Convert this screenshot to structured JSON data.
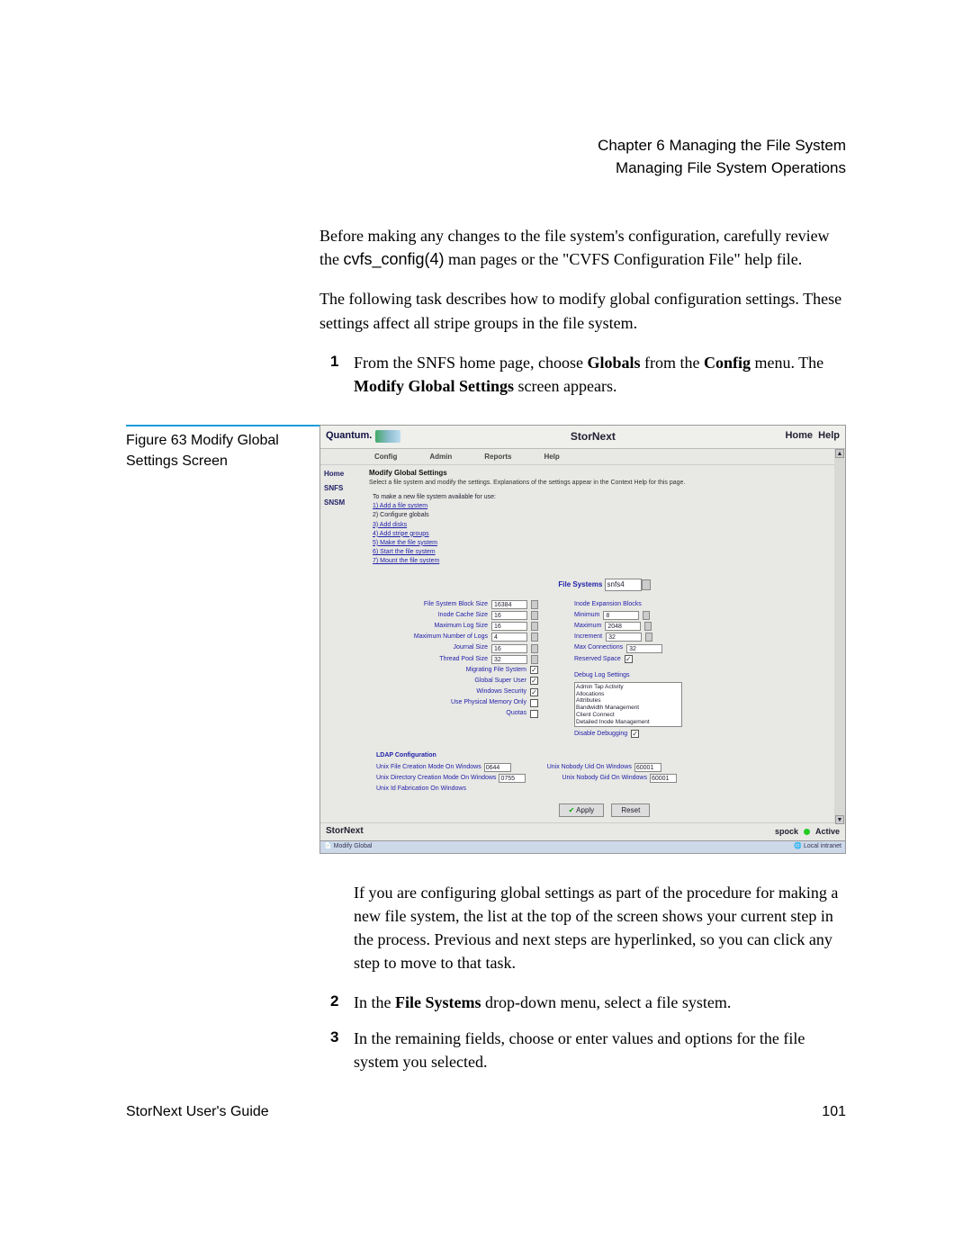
{
  "header": {
    "chapter": "Chapter 6  Managing the File System",
    "section": "Managing File System Operations"
  },
  "intro1": "Before making any changes to the file system's configuration, carefully review the ",
  "intro1_code": "cvfs_config(4)",
  "intro1_rest": " man pages or the \"CVFS Configuration File\" help file.",
  "intro2": "The following task describes how to modify global configuration settings. These settings affect all stripe groups in the file system.",
  "step1_a": "From the SNFS home page, choose ",
  "step1_b": "Globals",
  "step1_c": " from the ",
  "step1_d": "Config",
  "step1_e": " menu. The ",
  "step1_f": "Modify Global Settings",
  "step1_g": " screen appears.",
  "figure": {
    "label": "Figure 63  Modify Global Settings Screen"
  },
  "after1": "If you are configuring global settings as part of the procedure for making a new file system, the list at the top of the screen shows your current step in the process. Previous and next steps are hyperlinked, so you can click any step to move to that task.",
  "step2_a": "In the ",
  "step2_b": "File Systems",
  "step2_c": " drop-down menu, select a file system.",
  "step3": "In the remaining fields, choose or enter values and options for the file system you selected.",
  "footer": {
    "left": "StorNext User's Guide",
    "right": "101"
  },
  "ss": {
    "brand": "Quantum.",
    "title": "StorNext",
    "home": "Home",
    "help": "Help",
    "menu": {
      "m1": "Config",
      "m2": "Admin",
      "m3": "Reports",
      "m4": "Help"
    },
    "side": {
      "s1": "Home",
      "s2": "SNFS",
      "s3": "SNSM"
    },
    "panel_hdr": "Modify Global Settings",
    "panel_sub": "Select a file system and modify the settings. Explanations of the settings appear in the Context Help for this page.",
    "steps_hdr": "To make a new file system available for use:",
    "steps": {
      "s1": "1) Add a file system",
      "s2": "2) Configure globals",
      "s3": "3) Add disks",
      "s4": "4) Add stripe groups",
      "s5": "5) Make the file system",
      "s6": "6) Start the file system",
      "s7": "7) Mount the file system"
    },
    "fs_label": "File Systems",
    "fs_value": "snfs4",
    "left_opts": {
      "o1": {
        "l": "File System Block Size",
        "v": "16384"
      },
      "o2": {
        "l": "Inode Cache Size",
        "v": "16"
      },
      "o3": {
        "l": "Maximum Log Size",
        "v": "16"
      },
      "o4": {
        "l": "Maximum Number of Logs",
        "v": "4"
      },
      "o5": {
        "l": "Journal Size",
        "v": "16"
      },
      "o6": {
        "l": "Thread Pool Size",
        "v": "32"
      },
      "o7": {
        "l": "Migrating File System"
      },
      "o8": {
        "l": "Global Super User"
      },
      "o9": {
        "l": "Windows Security"
      },
      "o10": {
        "l": "Use Physical Memory Only"
      },
      "o11": {
        "l": "Quotas"
      }
    },
    "right_opts": {
      "hdr": "Inode Expansion Blocks",
      "r1": {
        "l": "Minimum",
        "v": "8"
      },
      "r2": {
        "l": "Maximum",
        "v": "2048"
      },
      "r3": {
        "l": "Increment",
        "v": "32"
      },
      "r4": {
        "l": "Max Connections",
        "v": "32"
      },
      "r5": {
        "l": "Reserved Space"
      },
      "dbg_hdr": "Debug Log Settings",
      "dbg_items": {
        "d1": "Admin Tap Activity",
        "d2": "Allocations",
        "d3": "Attributes",
        "d4": "Bandwidth Management",
        "d5": "Client Connect",
        "d6": "Detailed Inode Management"
      },
      "dis_dbg": "Disable Debugging"
    },
    "ldap": {
      "hdr": "LDAP Configuration",
      "l1": {
        "l": "Unix File Creation Mode On Windows",
        "v": "0644"
      },
      "l2": {
        "l": "Unix Nobody Uid On Windows",
        "v": "60001"
      },
      "l3": {
        "l": "Unix Directory Creation Mode On Windows",
        "v": "0755"
      },
      "l4": {
        "l": "Unix Nobody Gid On Windows",
        "v": "60001"
      },
      "l5": {
        "l": "Unix Id Fabrication On Windows"
      }
    },
    "btns": {
      "apply": "Apply",
      "reset": "Reset"
    },
    "footer": {
      "brand": "StorNext",
      "host": "spock",
      "status": "Active"
    },
    "status": {
      "left": "Modify Global",
      "right": "Local intranet"
    }
  }
}
